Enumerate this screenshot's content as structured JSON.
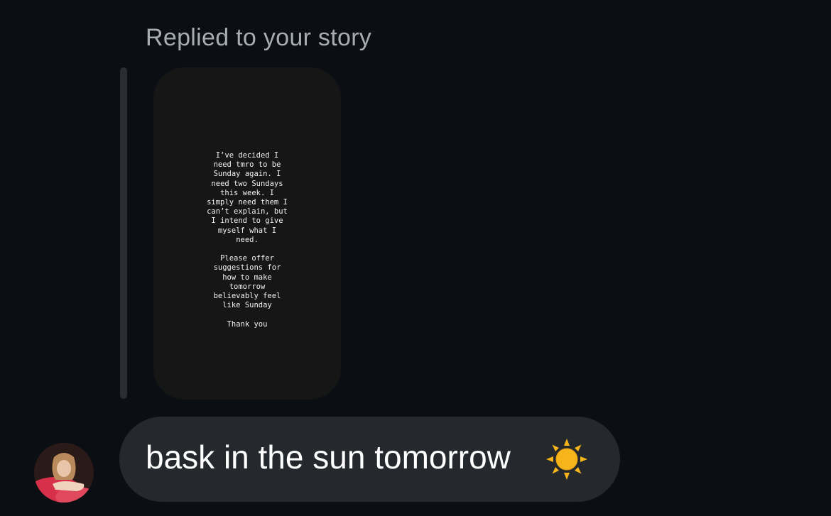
{
  "header": {
    "reply_label": "Replied to your story"
  },
  "story": {
    "text": "I’ve decided I\nneed tmro to be\nSunday again. I\nneed two Sundays\nthis week. I\nsimply need them I\ncan’t explain, but\nI intend to give\nmyself what I\nneed.\n\nPlease offer\nsuggestions for\nhow to make\ntomorrow\nbelievably feel\nlike Sunday\n\nThank you"
  },
  "message": {
    "text": "bask in the sun tomorrow",
    "emoji_icon": "sun-emoji-icon"
  },
  "colors": {
    "background": "#0b0f14",
    "bubble": "#25282d",
    "header_text": "#a8adb3",
    "story_bg": "#161616",
    "sun": "#f7b51c"
  }
}
